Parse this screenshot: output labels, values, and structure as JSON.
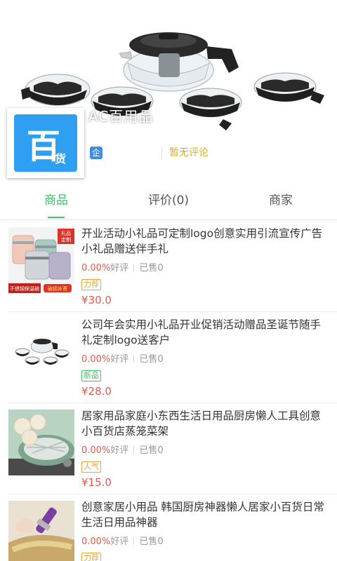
{
  "store": {
    "name_partial": "AC百用品",
    "logo_big_char": "百",
    "logo_small_char": "货",
    "enterprise_badge": "企",
    "review_status": "暂无评论"
  },
  "tabs": [
    {
      "label": "商品",
      "active": true
    },
    {
      "label": "评价(0)",
      "active": false
    },
    {
      "label": "商家",
      "active": false
    }
  ],
  "products": [
    {
      "title": " 开业活动小礼品可定制logo创意实用引流宣传广告小礼品赠送伴手礼",
      "rating": "0.00%",
      "rating_label": "好评",
      "sold": "已售0",
      "tag": "力荐",
      "tag_color": "orange",
      "price": "¥30.0",
      "thumb_text_top": "礼品定制",
      "thumb_text_bottom": "不锈钢保温碗",
      "thumb_text_button": "破损补寄"
    },
    {
      "title": "公司年会实用小礼品开业促销活动赠品圣诞节随手礼定制logo送客户",
      "rating": "0.00%",
      "rating_label": "好评",
      "sold": "已售0",
      "tag": "新品",
      "tag_color": "green",
      "price": "¥28.0"
    },
    {
      "title": "居家用品家庭小东西生活日用品厨房懒人工具创意小百货店蒸笼菜架",
      "rating": "0.00%",
      "rating_label": "好评",
      "sold": "已售0",
      "tag": "人气",
      "tag_color": "orange",
      "price": "¥15.0"
    },
    {
      "title": "创意家居小用品 韩国厨房神器懒人居家小百货日常生活日用品神器",
      "rating": "0.00%",
      "rating_label": "好评",
      "sold": "已售0",
      "tag": "力荐",
      "tag_color": "orange",
      "price": ""
    }
  ],
  "colors": {
    "accent_green": "#3cc464",
    "price_red": "#e05b4b",
    "review_yellow": "#d9b021",
    "logo_blue": "#2f9ff1"
  }
}
